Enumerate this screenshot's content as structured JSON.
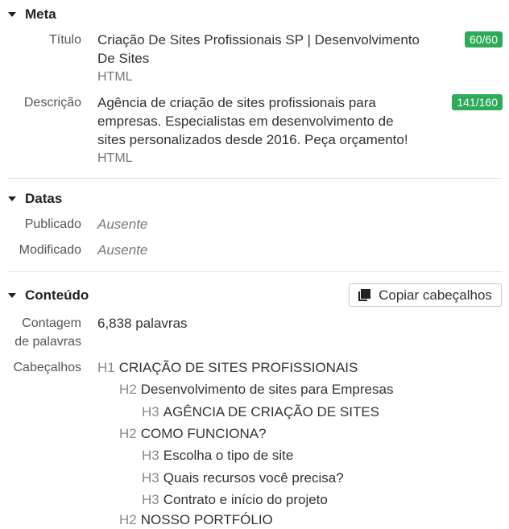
{
  "meta": {
    "heading": "Meta",
    "title_label": "Título",
    "title_line1": "Criação De Sites Profissionais SP | Desenvolvimento",
    "title_line2": "De Sites",
    "title_format": "HTML",
    "title_count": "60/60",
    "desc_label": "Descrição",
    "desc_line1": "Agência de criação de sites profissionais para",
    "desc_line2": "empresas. Especialistas em desenvolvimento de",
    "desc_line3": "sites personalizados desde 2016. Peça orçamento!",
    "desc_format": "HTML",
    "desc_count": "141/160"
  },
  "dates": {
    "heading": "Datas",
    "published_label": "Publicado",
    "published_value": "Ausente",
    "modified_label": "Modificado",
    "modified_value": "Ausente"
  },
  "content": {
    "heading": "Conteúdo",
    "copy_button": "Copiar cabeçalhos",
    "word_count_label_line1": "Contagem",
    "word_count_label_line2": "de palavras",
    "word_count": "6,838 palavras",
    "headings_label": "Cabeçalhos",
    "headings": [
      {
        "level": "H1",
        "text": "CRIAÇÃO DE SITES PROFISSIONAIS"
      },
      {
        "level": "H2",
        "text": "Desenvolvimento de sites para Empresas"
      },
      {
        "level": "H3",
        "text": "AGÊNCIA DE CRIAÇÃO DE SITES"
      },
      {
        "level": "H2",
        "text": "COMO FUNCIONA?"
      },
      {
        "level": "H3",
        "text": "Escolha o tipo de site"
      },
      {
        "level": "H3",
        "text": "Quais recursos você precisa?"
      },
      {
        "level": "H3",
        "text": "Contrato e início do projeto"
      },
      {
        "level": "H2",
        "text": "NOSSO PORTFÓLIO"
      }
    ]
  },
  "colors": {
    "badge": "#2eab5a"
  }
}
